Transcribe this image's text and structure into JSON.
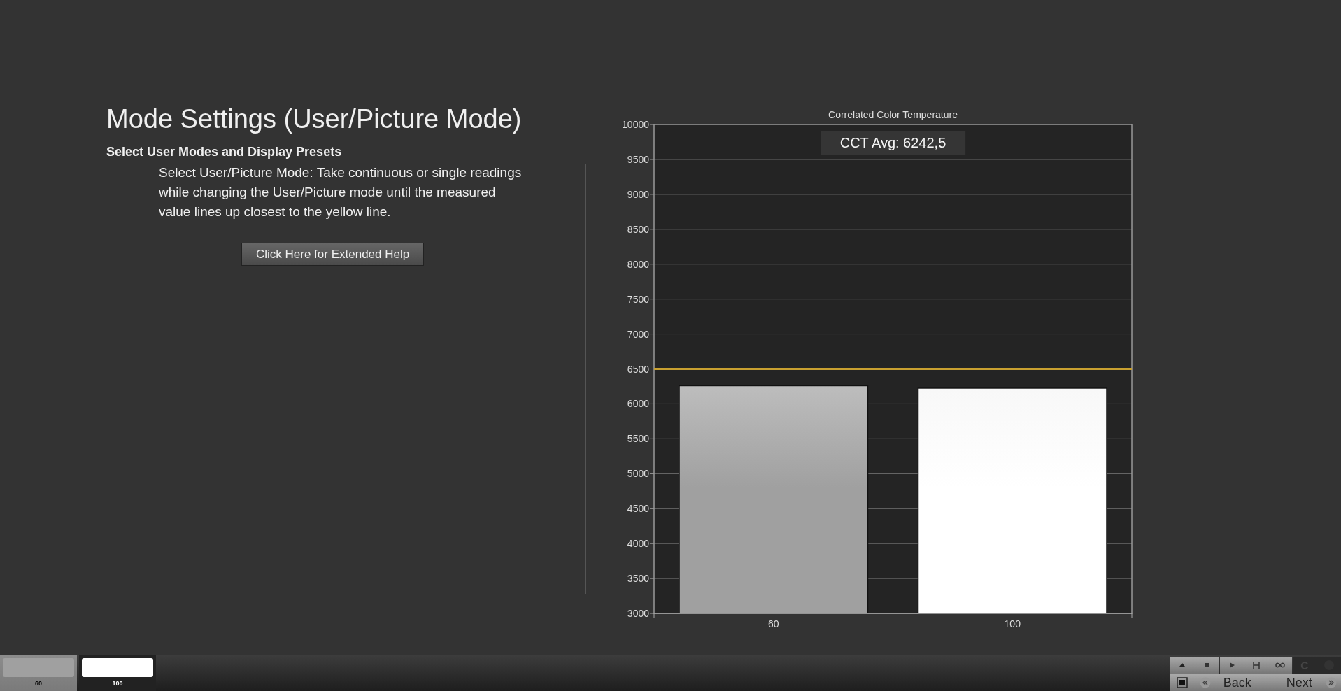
{
  "heading": "Mode Settings (User/Picture Mode)",
  "subheading": "Select User Modes and Display Presets",
  "description": "Select User/Picture Mode: Take continuous or single readings while changing the User/Picture mode until the measured value lines up closest to the yellow line.",
  "help_button": "Click Here for Extended Help",
  "chart": {
    "chart_data": {
      "type": "bar",
      "title": "Correlated Color Temperature",
      "categories": [
        "60",
        "100"
      ],
      "values": [
        6260,
        6225
      ],
      "ylim": [
        3000,
        10000
      ],
      "yticks": [
        3000,
        3500,
        4000,
        4500,
        5000,
        5500,
        6000,
        6500,
        7000,
        7500,
        8000,
        8500,
        9000,
        9500,
        10000
      ],
      "grid": true,
      "ref_lines": [
        {
          "axis": "y",
          "value": 6500,
          "color": "#c8a030"
        }
      ],
      "annotations": [
        {
          "text": "CCT Avg: 6242,5"
        }
      ]
    }
  },
  "swatches": [
    {
      "label": "60",
      "color": "#a0a0a0"
    },
    {
      "label": "100",
      "color": "#ffffff"
    }
  ],
  "nav_buttons": [
    {
      "label": "Back",
      "kind": "back"
    },
    {
      "label": "Next",
      "kind": "next"
    }
  ]
}
